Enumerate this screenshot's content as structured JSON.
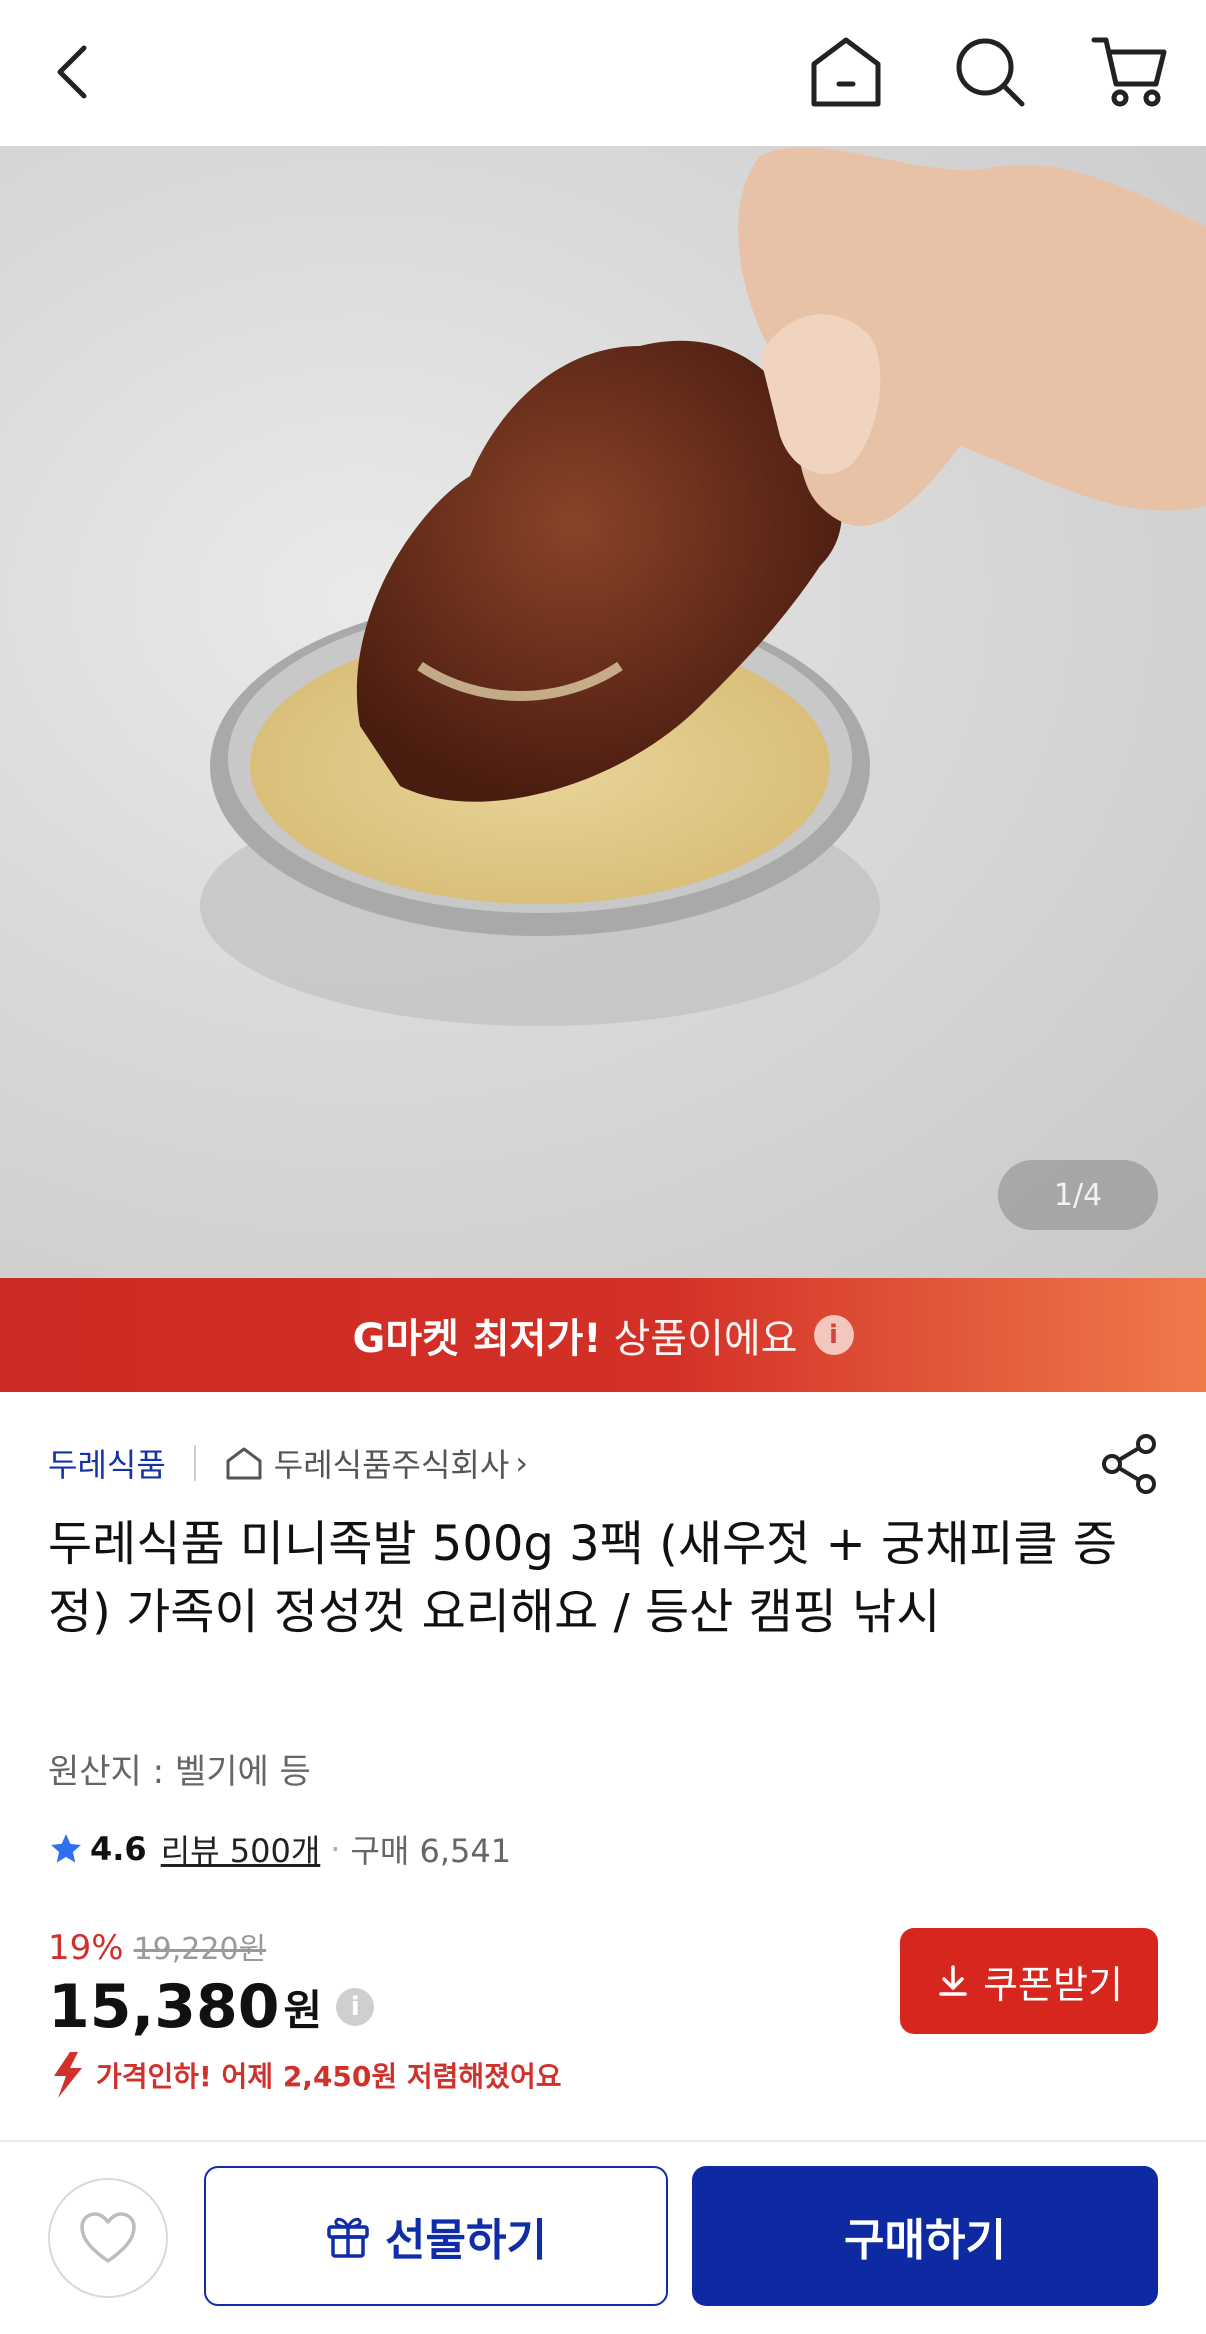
{
  "header": {
    "back_icon": "back-chevron-icon",
    "home_icon": "home-icon",
    "search_icon": "search-icon",
    "cart_icon": "cart-icon"
  },
  "gallery": {
    "counter": "1/4"
  },
  "banner": {
    "bold": "G마켓 최저가!",
    "light": "상품이에요",
    "info": "i"
  },
  "seller": {
    "brand": "두레식품",
    "store": "두레식품주식회사",
    "store_chevron": "›"
  },
  "product": {
    "title": "두레식품 미니족발 500g 3팩 (새우젓 + 궁채피클 증정) 가족이 정성껏 요리해요 / 등산 캠핑 낚시",
    "origin": "원산지 : 벨기에 등"
  },
  "rating": {
    "score": "4.6",
    "reviews": "리뷰 500개",
    "dot": "·",
    "buys": "구매 6,541"
  },
  "price": {
    "discount": "19%",
    "original": "19,220원",
    "final": "15,380",
    "unit": "원",
    "info": "i",
    "drop_msg": "가격인하! 어제 2,450원 저렴해졌어요"
  },
  "coupon": {
    "label": "쿠폰받기"
  },
  "bottom": {
    "gift_label": "선물하기",
    "buy_label": "구매하기"
  },
  "colors": {
    "accent_blue": "#0d2aa3",
    "accent_red": "#d7261e"
  }
}
